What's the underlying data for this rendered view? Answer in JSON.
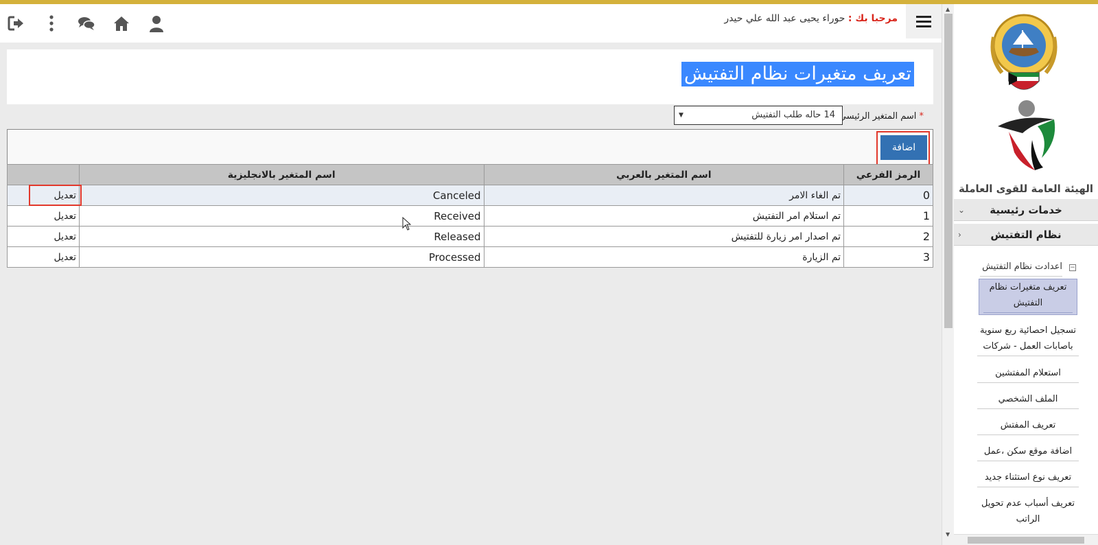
{
  "header": {
    "welcome_prefix": "مرحبا بك :",
    "user_name": "حوراء يحيى عبد الله علي حيدر",
    "icons": [
      "user-icon",
      "home-icon",
      "chat-icon",
      "more-vertical-icon",
      "logout-icon"
    ]
  },
  "sidebar": {
    "org_name": "الهيئة العامة للقوى العاملة",
    "sections": [
      "خدمات رئيسية",
      "نظام التفتيش"
    ],
    "group": "اعدادت نظام التفتيش",
    "items": [
      "تعريف متغيرات نظام التفتيش",
      "تسجيل احصائية ربع سنوية باصابات العمل - شركات",
      "استعلام المفتشين",
      "الملف الشخصي",
      "تعريف المفتش",
      "اضافة موقع سكن ،عمل",
      "تعريف نوع استثناء جديد",
      "تعريف أسباب عدم تحويل الراتب"
    ]
  },
  "page": {
    "title": "تعريف متغيرات نظام التفتيش",
    "field_label": "اسم المتغير الرئيسي",
    "required_mark": "*",
    "select_value": "14 حاله طلب التفتيش"
  },
  "grid": {
    "add_label": "اضافة",
    "columns": [
      "الرمز الفرعي",
      "اسم المتغير بالعربي",
      "اسم المتغير بالانجليزية",
      ""
    ],
    "rows": [
      {
        "code": "0",
        "arabic": "تم الغاء الامر",
        "english": "Canceled",
        "action": "تعديل"
      },
      {
        "code": "1",
        "arabic": "تم استلام امر التفتيش",
        "english": "Received",
        "action": "تعديل"
      },
      {
        "code": "2",
        "arabic": "تم اصدار امر زيارة للتفتيش",
        "english": "Released",
        "action": "تعديل"
      },
      {
        "code": "3",
        "arabic": "تم الزيارة",
        "english": "Processed",
        "action": "تعديل"
      }
    ]
  },
  "colors": {
    "accent_line": "#d4b13b",
    "button_blue": "#3371b3",
    "title_highlight": "#3a88ff",
    "highlight_red": "#e2382b"
  }
}
